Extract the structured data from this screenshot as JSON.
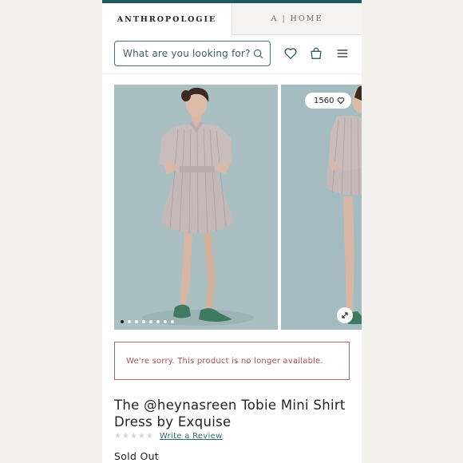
{
  "header": {
    "tabs": [
      {
        "label": "ANTHROPOLOGIE",
        "active": true
      },
      {
        "label": "A | HOME",
        "active": false
      }
    ],
    "search": {
      "placeholder": "What are you looking for?"
    },
    "icons": [
      "search-icon",
      "heart-icon",
      "bag-icon",
      "menu-icon"
    ]
  },
  "gallery": {
    "like_count": "1560",
    "slide_count": 8,
    "active_slide": 1
  },
  "alert": {
    "message": "We're sorry. This product is no longer available."
  },
  "product": {
    "title": "The @heynasreen Tobie Mini Shirt Dress by Exquise",
    "rating": 0,
    "write_review_label": "Write a Review",
    "status": "Sold Out"
  },
  "colors": {
    "brand_teal": "#1e5a5f",
    "alert_red": "#a9514e",
    "link": "#2e6a74"
  }
}
